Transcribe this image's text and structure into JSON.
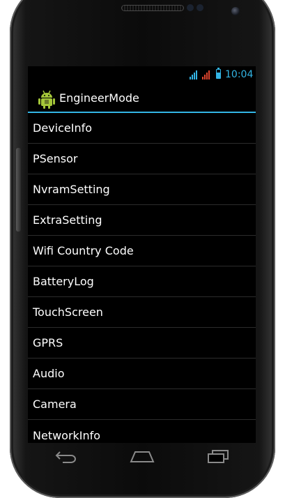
{
  "statusbar": {
    "time": "10:04",
    "accent_color": "#33b5e5",
    "warning_color": "#e0452e",
    "icons": [
      "wifi-signal-icon",
      "cell-signal-icon",
      "battery-icon"
    ]
  },
  "app": {
    "title": "EngineerMode",
    "icon": "android-robot-icon",
    "accent_color": "#33b5e5"
  },
  "menu": {
    "items": [
      {
        "label": "DeviceInfo"
      },
      {
        "label": "PSensor"
      },
      {
        "label": "NvramSetting"
      },
      {
        "label": "ExtraSetting"
      },
      {
        "label": "Wifi Country Code"
      },
      {
        "label": "BatteryLog"
      },
      {
        "label": "TouchScreen"
      },
      {
        "label": "GPRS"
      },
      {
        "label": "Audio"
      },
      {
        "label": "Camera"
      },
      {
        "label": "NetworkInfo"
      }
    ]
  },
  "navbar": {
    "buttons": [
      "back-icon",
      "home-icon",
      "recent-apps-icon"
    ]
  }
}
